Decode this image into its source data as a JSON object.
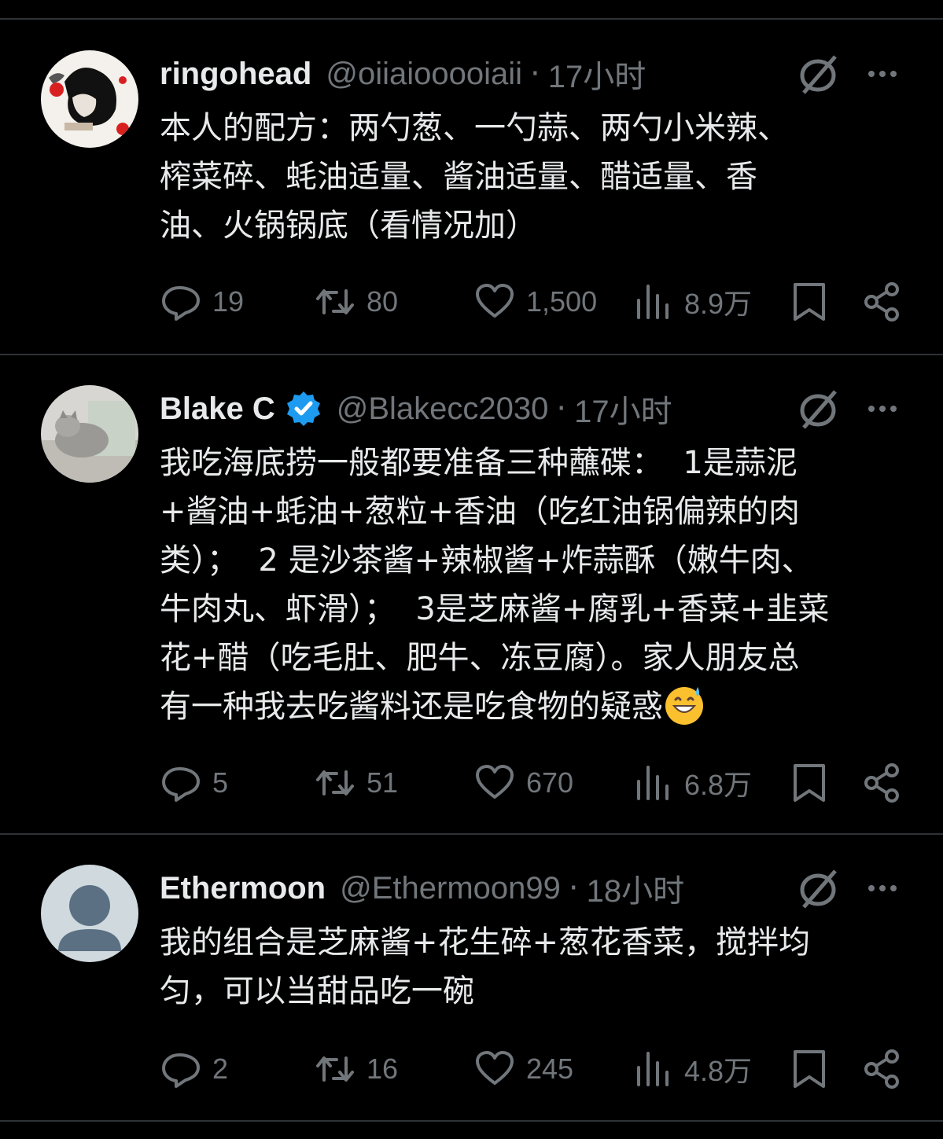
{
  "tweets": [
    {
      "name": "ringohead",
      "handle": "@oiiaiooooiaii",
      "time": "17小时",
      "verified": false,
      "text": "本人的配方：两勺葱、一勺蒜、两勺小米辣、\n榨菜碎、蚝油适量、酱油适量、醋适量、香\n油、火锅锅底（看情况加）",
      "replies": "19",
      "retweets": "80",
      "likes": "1,500",
      "views": "8.9万"
    },
    {
      "name": "Blake C",
      "handle": "@Blakecc2030",
      "time": "17小时",
      "verified": true,
      "text": "我吃海底捞一般都要准备三种蘸碟：  1是蒜泥\n+酱油+蚝油+葱粒+香油（吃红油锅偏辣的肉\n类）；  2 是沙茶酱+辣椒酱+炸蒜酥（嫩牛肉、\n牛肉丸、虾滑）；  3是芝麻酱+腐乳+香菜+韭菜\n花+醋（吃毛肚、肥牛、冻豆腐）。家人朋友总\n有一种我去吃酱料还是吃食物的疑惑",
      "emoji": "grinning-face-with-sweat",
      "replies": "5",
      "retweets": "51",
      "likes": "670",
      "views": "6.8万"
    },
    {
      "name": "Ethermoon",
      "handle": "@Ethermoon99",
      "time": "18小时",
      "verified": false,
      "text": "我的组合是芝麻酱+花生碎+葱花香菜，搅拌均\n匀，可以当甜品吃一碗",
      "replies": "2",
      "retweets": "16",
      "likes": "245",
      "views": "4.8万"
    }
  ],
  "separator": "·",
  "colors": {
    "background": "#000000",
    "text": "#e7e9ea",
    "muted": "#71767b",
    "verified": "#1d9bf0",
    "divider": "#2f3336"
  },
  "icons": [
    "grok-icon",
    "more-icon",
    "reply-icon",
    "retweet-icon",
    "like-icon",
    "views-icon",
    "bookmark-icon",
    "share-icon",
    "verified-badge-icon"
  ]
}
